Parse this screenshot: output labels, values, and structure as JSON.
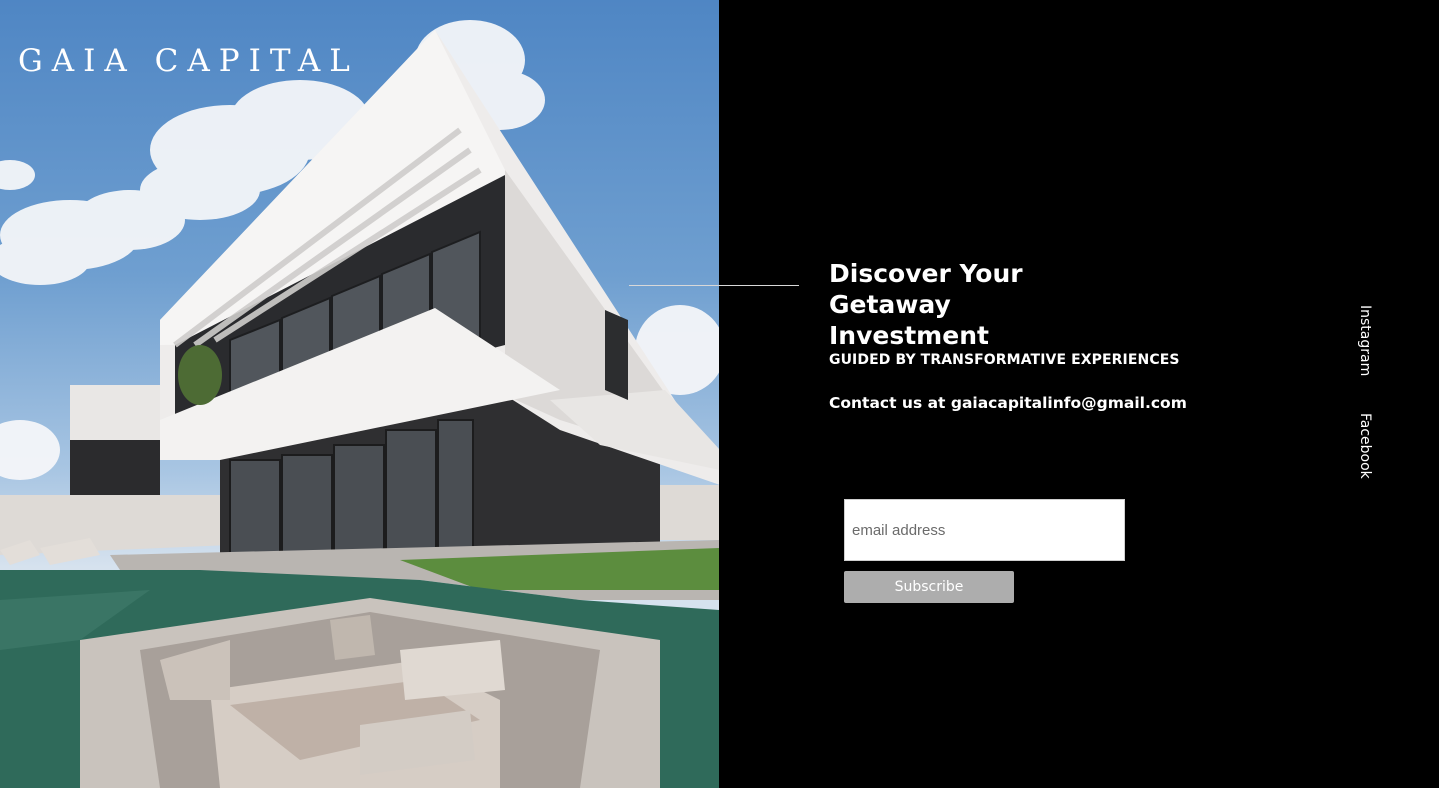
{
  "brand": {
    "name": "GAIA CAPITAL"
  },
  "hero": {
    "icon": "villa-photo"
  },
  "content": {
    "headline": "Discover Your Getaway Investment",
    "tagline": "GUIDED BY TRANSFORMATIVE EXPERIENCES",
    "contact": "Contact us at gaiacapitalinfo@gmail.com"
  },
  "subscribe": {
    "email_placeholder": "email address",
    "email_value": "",
    "button_label": "Subscribe"
  },
  "social": {
    "instagram_label": "Instagram",
    "facebook_label": "Facebook"
  },
  "colors": {
    "background": "#000000",
    "text": "#ffffff",
    "button": "#adadad",
    "divider": "#d8d8d8"
  }
}
